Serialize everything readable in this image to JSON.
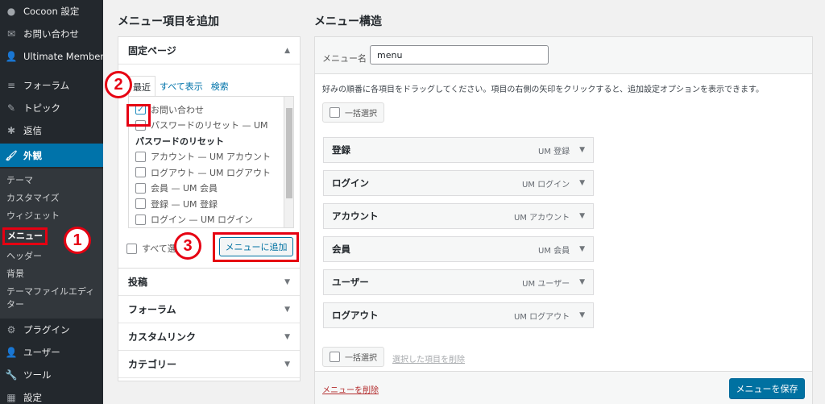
{
  "sidebar": {
    "items_top": [
      {
        "label": "Cocoon 設定",
        "icon": "cocoon-icon"
      },
      {
        "label": "お問い合わせ",
        "icon": "mail-icon"
      },
      {
        "label": "Ultimate Member",
        "icon": "user-icon"
      },
      {
        "label": "フォーラム",
        "icon": "forum-icon"
      },
      {
        "label": "トピック",
        "icon": "topic-icon"
      },
      {
        "label": "返信",
        "icon": "reply-icon"
      }
    ],
    "active": {
      "label": "外観",
      "icon": "appearance-icon"
    },
    "submenu": [
      "テーマ",
      "カスタマイズ",
      "ウィジェット",
      "メニュー",
      "ヘッダー",
      "背景",
      "テーマファイルエディター"
    ],
    "items_bottom": [
      {
        "label": "プラグイン",
        "icon": "plugin-icon"
      },
      {
        "label": "ユーザー",
        "icon": "users-icon"
      },
      {
        "label": "ツール",
        "icon": "wrench-icon"
      },
      {
        "label": "設定",
        "icon": "settings-icon"
      }
    ]
  },
  "annotations": {
    "m1": "1",
    "m2": "2",
    "m3": "3"
  },
  "add_items": {
    "title": "メニュー項目を追加",
    "pages": {
      "heading": "固定ページ",
      "tabs": [
        "最近",
        "すべて表示",
        "検索"
      ],
      "list": [
        {
          "label": "お問い合わせ",
          "checked": true,
          "bold": false,
          "indent": true
        },
        {
          "label": "パスワードのリセット — UM",
          "checked": false,
          "bold": false,
          "indent": true
        },
        {
          "label": "パスワードのリセット",
          "checked": false,
          "bold": true,
          "indent": false,
          "no_checkbox": true
        },
        {
          "label": "アカウント — UM アカウント",
          "checked": false,
          "bold": false,
          "indent": false
        },
        {
          "label": "ログアウト — UM ログアウト",
          "checked": false,
          "bold": false,
          "indent": false
        },
        {
          "label": "会員 — UM 会員",
          "checked": false,
          "bold": false,
          "indent": false
        },
        {
          "label": "登録 — UM 登録",
          "checked": false,
          "bold": false,
          "indent": false
        },
        {
          "label": "ログイン — UM ログイン",
          "checked": false,
          "bold": false,
          "indent": false
        }
      ],
      "select_all": "すべて選択",
      "add_button": "メニューに追加"
    },
    "sections": [
      "投稿",
      "フォーラム",
      "カスタムリンク",
      "カテゴリー"
    ]
  },
  "structure": {
    "title": "メニュー構造",
    "name_label": "メニュー名",
    "name_value": "menu",
    "instructions": "好みの順番に各項目をドラッグしてください。項目の右側の矢印をクリックすると、追加設定オプションを表示できます。",
    "bulk_select": "一括選択",
    "items": [
      {
        "title": "登録",
        "type": "UM 登録"
      },
      {
        "title": "ログイン",
        "type": "UM ログイン"
      },
      {
        "title": "アカウント",
        "type": "UM アカウント"
      },
      {
        "title": "会員",
        "type": "UM 会員"
      },
      {
        "title": "ユーザー",
        "type": "UM ユーザー"
      },
      {
        "title": "ログアウト",
        "type": "UM ログアウト"
      }
    ],
    "bulk_select_bottom": "一括選択",
    "remove_selected": "選択した項目を削除",
    "delete_menu": "メニューを削除",
    "save_menu": "メニューを保存"
  },
  "colors": {
    "accent": "#0073aa",
    "annotation_red": "#e60012",
    "delete_red": "#b32d2e"
  }
}
